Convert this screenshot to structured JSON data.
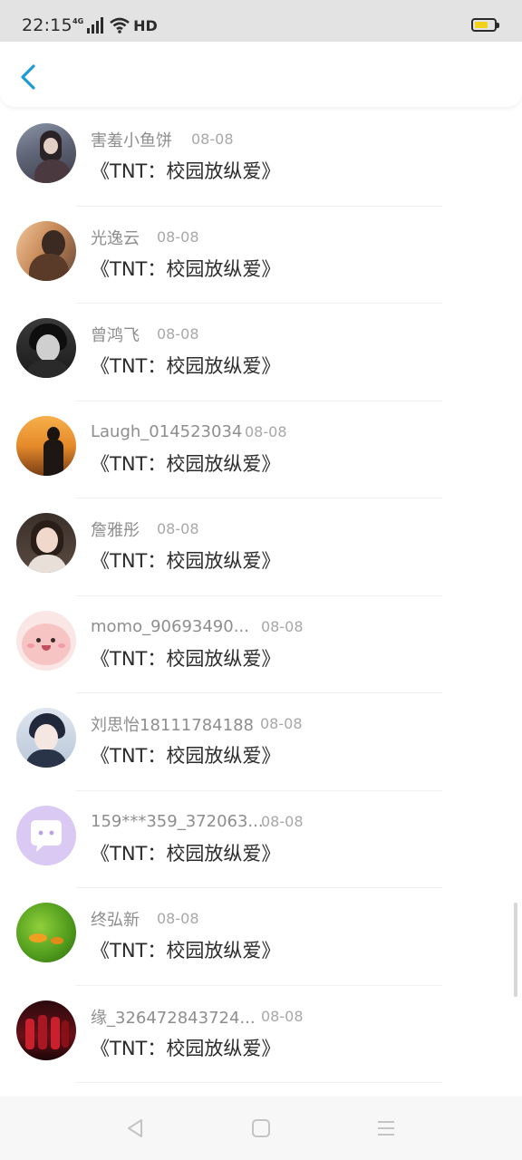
{
  "status_bar": {
    "time": "22:15",
    "network_label": "4G",
    "hd_label": "HD",
    "battery_level": 0.7,
    "battery_color": "#f2d21b"
  },
  "header": {
    "back_icon": "chevron-left-icon",
    "accent_color": "#1d9bd8"
  },
  "comments": [
    {
      "user": "害羞小鱼饼",
      "date": "08-08",
      "title": "《TNT：校园放纵爱》"
    },
    {
      "user": "光逸云",
      "date": "08-08",
      "title": "《TNT：校园放纵爱》"
    },
    {
      "user": "曾鸿飞",
      "date": "08-08",
      "title": "《TNT：校园放纵爱》"
    },
    {
      "user": "Laugh_014523034",
      "date": "08-08",
      "title": "《TNT：校园放纵爱》"
    },
    {
      "user": "詹雅彤",
      "date": "08-08",
      "title": "《TNT：校园放纵爱》"
    },
    {
      "user": "momo_90693490...",
      "date": "08-08",
      "title": "《TNT：校园放纵爱》"
    },
    {
      "user": "刘思怡18111784188",
      "date": "08-08",
      "title": "《TNT：校园放纵爱》"
    },
    {
      "user": "159***359_372063...",
      "date": "08-08",
      "title": "《TNT：校园放纵爱》"
    },
    {
      "user": "终弘新",
      "date": "08-08",
      "title": "《TNT：校园放纵爱》"
    },
    {
      "user": "缘_326472843724...",
      "date": "08-08",
      "title": "《TNT：校园放纵爱》"
    }
  ],
  "nav_bar": {
    "back_icon": "triangle-back-icon",
    "home_icon": "square-home-icon",
    "menu_icon": "menu-lines-icon"
  }
}
